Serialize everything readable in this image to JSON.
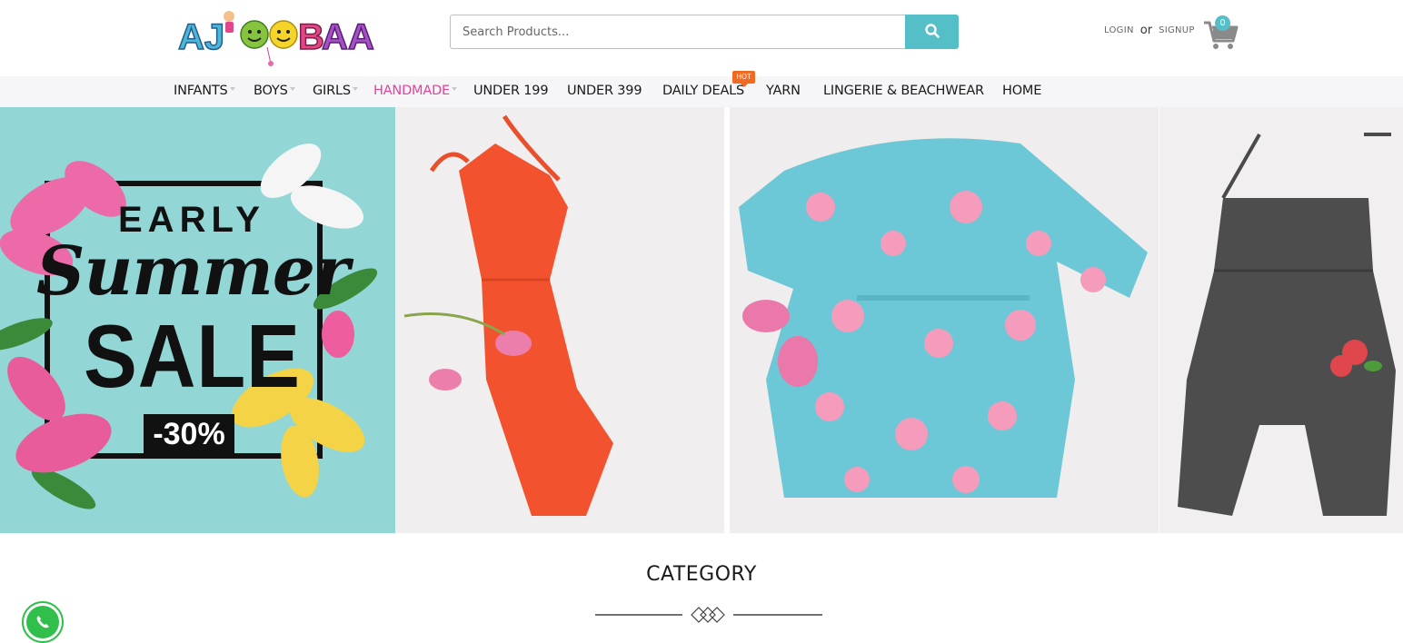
{
  "header": {
    "logo_text": "AJOOBAA",
    "search": {
      "placeholder": "Search Products..."
    },
    "auth": {
      "login": "LOGIN",
      "or": "or",
      "signup": "SIGNUP"
    },
    "cart": {
      "count": "0"
    }
  },
  "nav": {
    "items": [
      {
        "label": "INFANTS",
        "caret": true
      },
      {
        "label": "BOYS",
        "caret": true
      },
      {
        "label": "GIRLS",
        "caret": true
      },
      {
        "label": "HANDMADE",
        "caret": true,
        "active": true
      },
      {
        "label": "UNDER 199"
      },
      {
        "label": "UNDER 399"
      },
      {
        "label": "DAILY DEALS",
        "badge": "HOT"
      },
      {
        "label": "YARN"
      },
      {
        "label": "LINGERIE & BEACHWEAR"
      },
      {
        "label": "HOME"
      }
    ]
  },
  "banner": {
    "sale": {
      "early": "EARLY",
      "summer": "Summer",
      "sale": "SALE",
      "discount": "-30%"
    },
    "panels": [
      {
        "icon": "orange-jumpsuit-image"
      },
      {
        "icon": "floral-romper-image"
      },
      {
        "icon": "grey-jumpsuit-image"
      }
    ]
  },
  "section": {
    "title": "CATEGORY"
  },
  "colors": {
    "accent": "#55bfc8",
    "active_nav": "#e0449a",
    "hot_badge": "#f06a24",
    "whatsapp": "#2fbf4a"
  },
  "icons": {
    "search": "search-icon",
    "cart": "cart-icon",
    "whatsapp": "whatsapp-icon"
  }
}
